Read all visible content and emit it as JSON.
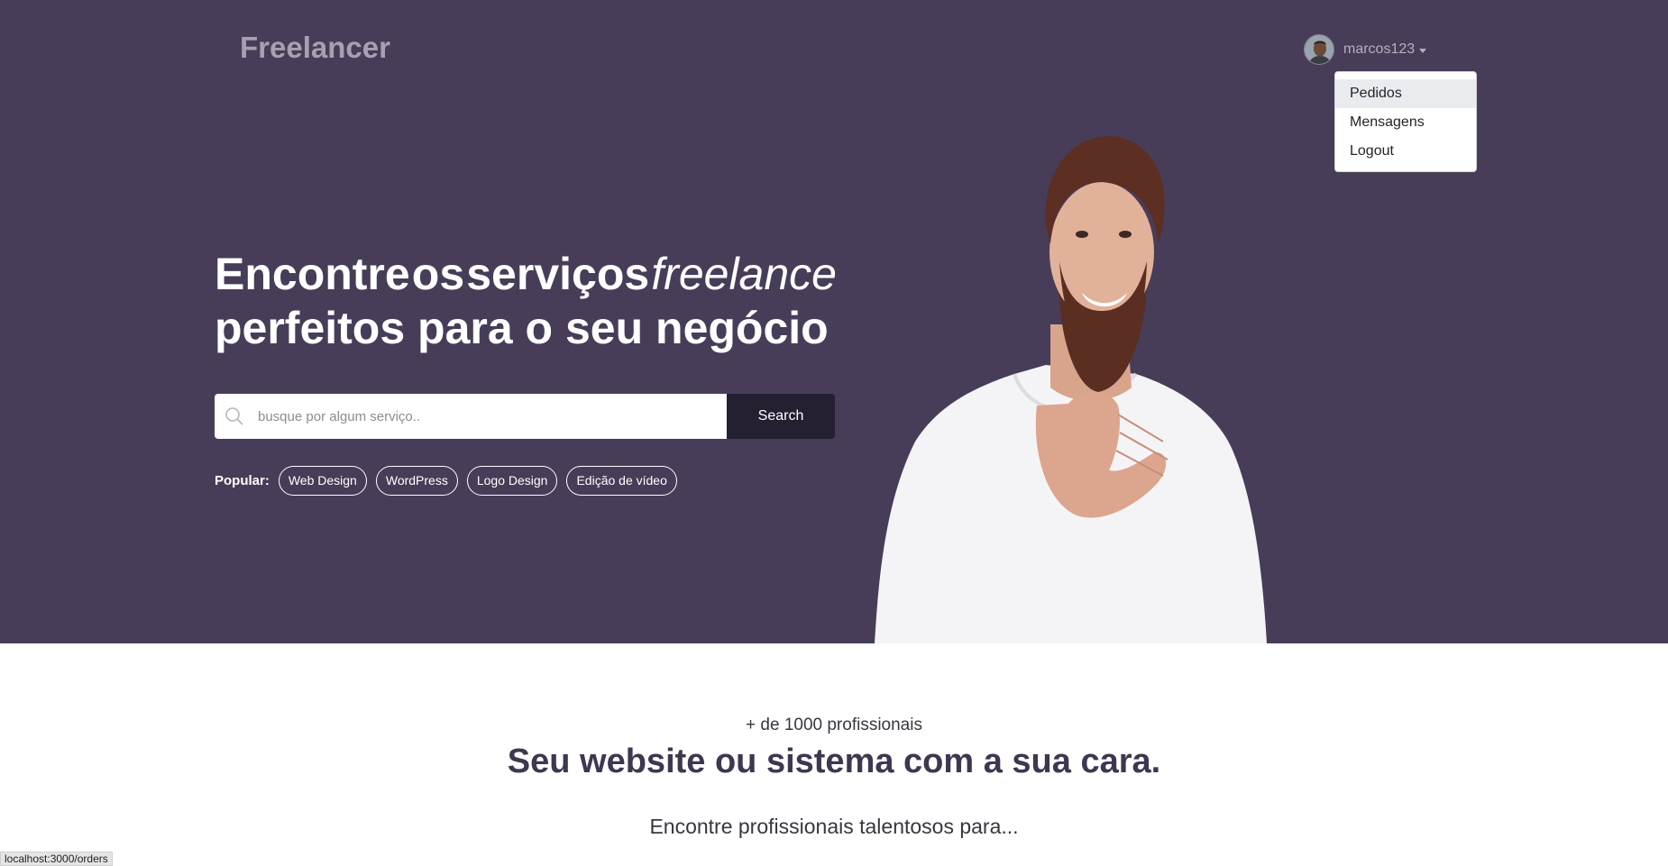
{
  "brand": "Freelancer",
  "user": {
    "name": "marcos123"
  },
  "dropdown": {
    "items": [
      "Pedidos",
      "Mensagens",
      "Logout"
    ]
  },
  "hero": {
    "headline_word1": "Encontre",
    "headline_word2": "os",
    "headline_word3": "serviços",
    "headline_italic": "freelance",
    "headline_line2": "perfeitos para o seu negócio",
    "search_placeholder": "busque por algum serviço..",
    "search_button": "Search",
    "popular_label": "Popular:",
    "tags": [
      "Web Design",
      "WordPress",
      "Logo Design",
      "Edição de vídeo"
    ]
  },
  "section": {
    "subtitle": "+ de 1000 profissionais",
    "title": "Seu website ou sistema com a sua cara.",
    "lead": "Encontre profissionais talentosos para..."
  },
  "statusbar": {
    "url": "localhost:3000/orders"
  },
  "colors": {
    "hero_bg": "#473d58",
    "button_bg": "#241f31",
    "title": "#3f3650"
  }
}
